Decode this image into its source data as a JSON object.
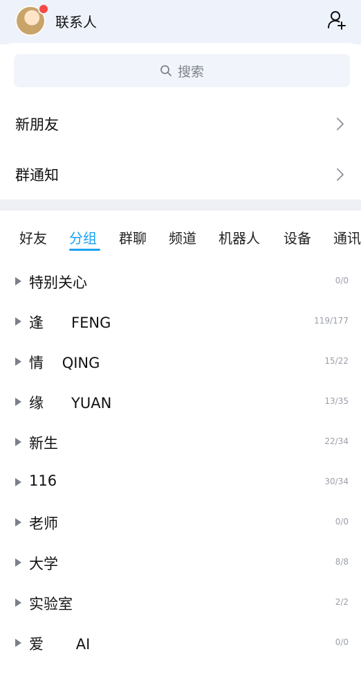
{
  "header": {
    "title": "联系人",
    "icons": [
      "avatar",
      "add-friend-icon"
    ],
    "notification_dot_color": "#f54a45"
  },
  "search": {
    "placeholder": "搜索"
  },
  "menu_rows": [
    {
      "label": "新朋友"
    },
    {
      "label": "群通知"
    }
  ],
  "tabs": [
    {
      "label": "好友",
      "active": false
    },
    {
      "label": "分组",
      "active": true
    },
    {
      "label": "群聊",
      "active": false
    },
    {
      "label": "频道",
      "active": false
    },
    {
      "label": "机器人",
      "active": false
    },
    {
      "label": "设备",
      "active": false
    },
    {
      "label": "通讯",
      "active": false
    }
  ],
  "accent_color": "#1aa1f3",
  "groups": [
    {
      "name": "特别关心",
      "count": "0/0"
    },
    {
      "name": "逢      FENG",
      "count": "119/177"
    },
    {
      "name": "情    QING",
      "count": "15/22"
    },
    {
      "name": "缘      YUAN",
      "count": "13/35"
    },
    {
      "name": "新生",
      "count": "22/34"
    },
    {
      "name": "116",
      "count": "30/34"
    },
    {
      "name": "老师",
      "count": "0/0"
    },
    {
      "name": "大学",
      "count": "8/8"
    },
    {
      "name": "实验室",
      "count": "2/2"
    },
    {
      "name": "爱       AI",
      "count": "0/0"
    }
  ]
}
